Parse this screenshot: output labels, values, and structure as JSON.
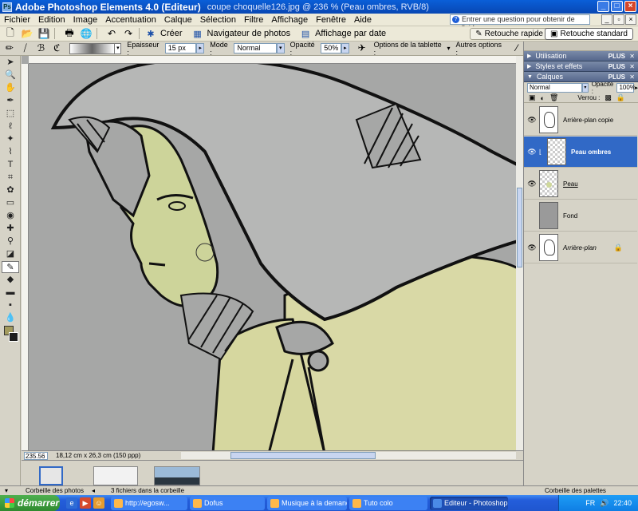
{
  "window": {
    "app_title": "Adobe Photoshop Elements 4.0 (Editeur)",
    "doc_title": "coupe choquelle126.jpg @ 236 % (Peau ombres, RVB/8)"
  },
  "menu": [
    "Fichier",
    "Edition",
    "Image",
    "Accentuation",
    "Calque",
    "Sélection",
    "Filtre",
    "Affichage",
    "Fenêtre",
    "Aide"
  ],
  "help_placeholder": "Entrer une question pour obtenir de l'aide",
  "shortcuts": {
    "create": "Créer",
    "navigator": "Navigateur de photos",
    "date_view": "Affichage par date",
    "quick_fix": "Retouche rapide",
    "standard_edit": "Retouche standard"
  },
  "options": {
    "size_label": "Epaisseur :",
    "size_value": "15 px",
    "mode_label": "Mode :",
    "mode_value": "Normal",
    "opacity_label": "Opacité :",
    "opacity_value": "50%",
    "tablet_label": "Options de la tablette :",
    "other_label": "Autres options :"
  },
  "palettes": {
    "sections": [
      {
        "label": "Utilisation",
        "more": "PLUS"
      },
      {
        "label": "Styles et effets",
        "more": "PLUS"
      },
      {
        "label": "Calques",
        "more": "PLUS"
      }
    ],
    "blend_mode": "Normal",
    "opacity_label": "Opacité :",
    "opacity_value": "100%",
    "lock_label": "Verrou :",
    "layers": [
      {
        "name": "Arrière-plan copie",
        "selected": false
      },
      {
        "name": "Peau ombres",
        "selected": true
      },
      {
        "name": "Peau",
        "selected": false
      },
      {
        "name": "Fond",
        "selected": false
      },
      {
        "name": "Arrière-plan",
        "selected": false
      }
    ],
    "footer": "Corbeille des palettes"
  },
  "status": {
    "zoom": "235.56 %",
    "dimensions": "18,12 cm x 26,3 cm (150 ppp)"
  },
  "bottom": {
    "photo_bin": "Corbeille des photos",
    "files": "3 fichiers dans la corbeille"
  },
  "taskbar": {
    "start": "démarrer",
    "tasks": [
      "http://egosw...",
      "Dofus",
      "Musique à la demand...",
      "Tuto colo",
      "Editeur - Photoshop E..."
    ],
    "lang": "FR",
    "time": "22:40"
  },
  "colors": {
    "foreground": "#a39b5e",
    "background": "#1d1d1d",
    "skin": "#cdd49a",
    "selected_layer": "#3169c6"
  }
}
